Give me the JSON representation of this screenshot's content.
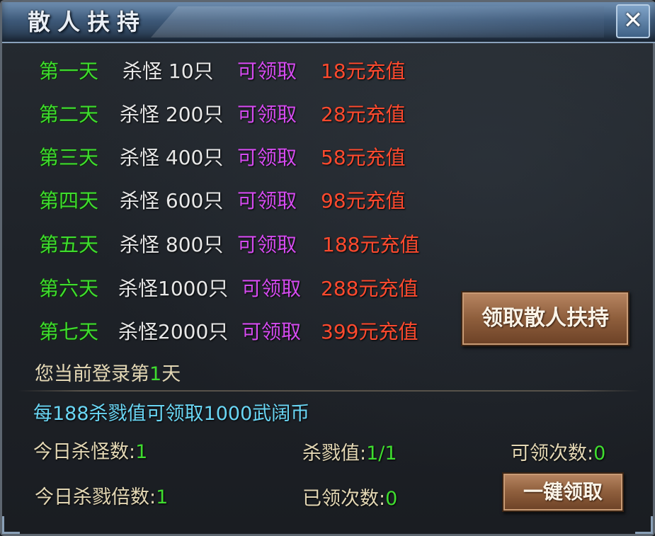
{
  "window": {
    "title": "散人扶持",
    "close_label": "✕"
  },
  "rows": [
    {
      "day": "第一天",
      "kill": "杀怪  10只",
      "claim": "可领取",
      "reward": "18元充值"
    },
    {
      "day": "第二天",
      "kill": "杀怪 200只",
      "claim": "可领取",
      "reward": "28元充值"
    },
    {
      "day": "第三天",
      "kill": "杀怪 400只",
      "claim": "可领取",
      "reward": "58元充值"
    },
    {
      "day": "第四天",
      "kill": "杀怪 600只",
      "claim": "可领取",
      "reward": "98元充值"
    },
    {
      "day": "第五天",
      "kill": "杀怪 800只",
      "claim": "可领取",
      "reward": "188元充值"
    },
    {
      "day": "第六天",
      "kill": "杀怪1000只",
      "claim": "可领取",
      "reward": "288元充值"
    },
    {
      "day": "第七天",
      "kill": "杀怪2000只",
      "claim": "可领取",
      "reward": "399元充值"
    }
  ],
  "claim_support_button": "领取散人扶持",
  "login": {
    "prefix": "您当前登录第",
    "day": "1",
    "suffix": "天"
  },
  "info": "每188杀戮值可领取1000武阔币",
  "stats": {
    "today_kills_label": "今日杀怪数:",
    "today_kills": "1",
    "slaughter_label": "杀戮值:",
    "slaughter": "1/1",
    "claimable_label": "可领次数:",
    "claimable": "0",
    "multiplier_label": "今日杀戮倍数:",
    "multiplier": "1",
    "claimed_label": "已领次数:",
    "claimed": "0"
  },
  "one_key_button": "一键领取",
  "colors": {
    "day": "#3fdc2f",
    "claim": "#d54bf0",
    "reward": "#ff4a2e",
    "info": "#6ad6f4"
  }
}
